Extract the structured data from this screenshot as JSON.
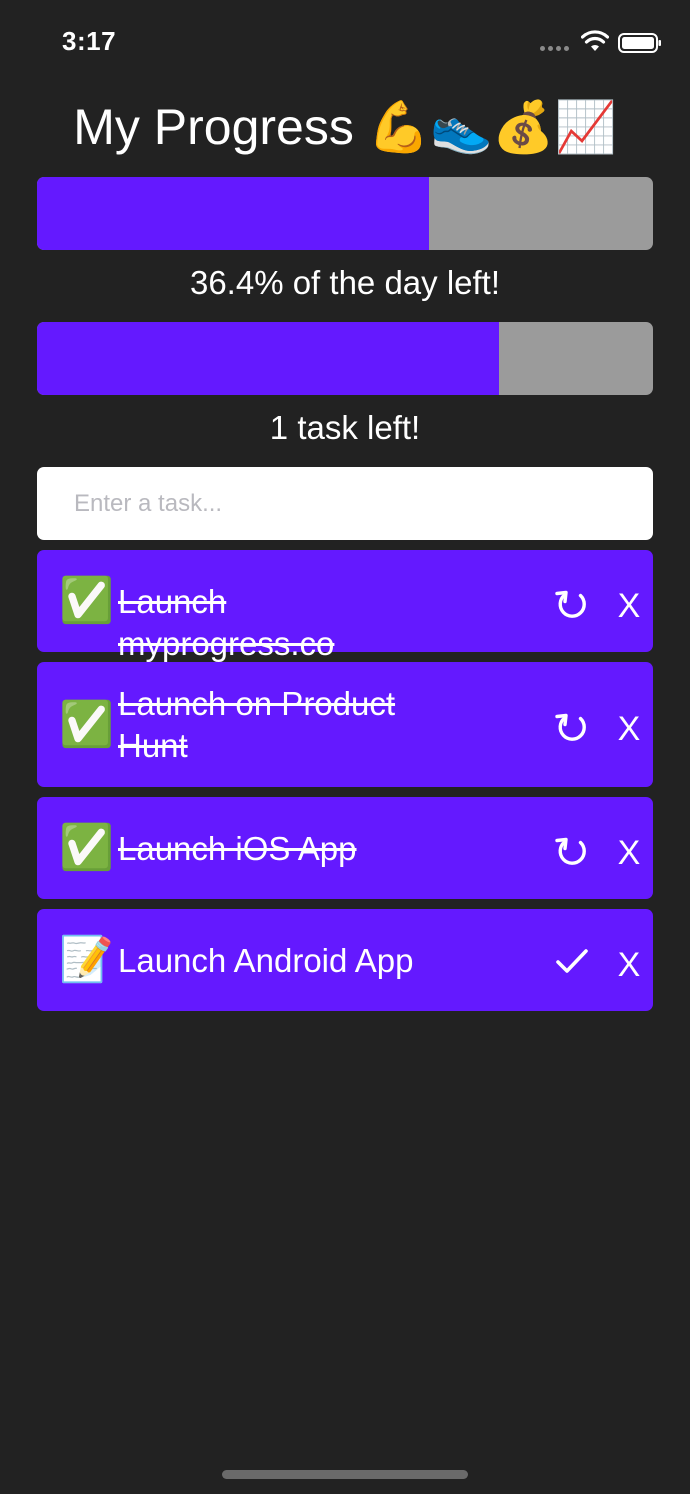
{
  "status_bar": {
    "time": "3:17"
  },
  "header": {
    "title": "My Progress 💪👟💰📈"
  },
  "day_progress": {
    "fraction_filled": 0.636,
    "label": "36.4% of the day left!",
    "fill_color": "#6419ff",
    "track_color": "#9b9b9b"
  },
  "task_progress": {
    "fraction_filled": 0.75,
    "label": "1 task left!",
    "fill_color": "#6419ff",
    "track_color": "#9b9b9b"
  },
  "task_input": {
    "placeholder": "Enter a task...",
    "value": ""
  },
  "tasks": [
    {
      "icon": "✅",
      "icon_name": "check-mark-button-icon",
      "text": "Launch myprogress.co",
      "done": true,
      "action_icon": "↺",
      "delete_label": "X"
    },
    {
      "icon": "✅",
      "icon_name": "check-mark-button-icon",
      "text": "Launch on Product Hunt",
      "done": true,
      "action_icon": "↺",
      "delete_label": "X"
    },
    {
      "icon": "✅",
      "icon_name": "check-mark-button-icon",
      "text": "Launch iOS App",
      "done": true,
      "action_icon": "↺",
      "delete_label": "X"
    },
    {
      "icon": "📝",
      "icon_name": "memo-icon",
      "text": "Launch Android App",
      "done": false,
      "action_icon": "✓",
      "delete_label": "X"
    }
  ],
  "colors": {
    "background": "#222222",
    "accent": "#6419ff"
  }
}
